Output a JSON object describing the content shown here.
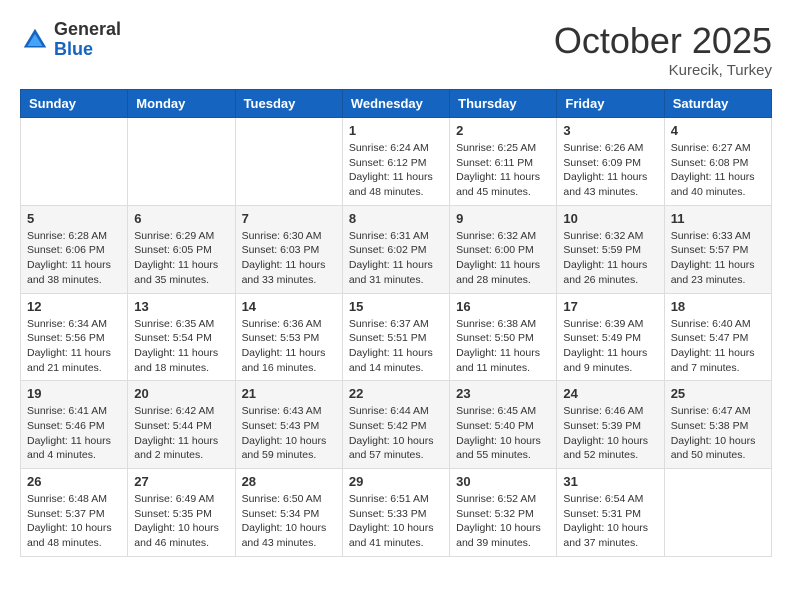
{
  "header": {
    "logo_general": "General",
    "logo_blue": "Blue",
    "month": "October 2025",
    "location": "Kurecik, Turkey"
  },
  "days_of_week": [
    "Sunday",
    "Monday",
    "Tuesday",
    "Wednesday",
    "Thursday",
    "Friday",
    "Saturday"
  ],
  "weeks": [
    [
      {
        "day": "",
        "sunrise": "",
        "sunset": "",
        "daylight": ""
      },
      {
        "day": "",
        "sunrise": "",
        "sunset": "",
        "daylight": ""
      },
      {
        "day": "",
        "sunrise": "",
        "sunset": "",
        "daylight": ""
      },
      {
        "day": "1",
        "sunrise": "Sunrise: 6:24 AM",
        "sunset": "Sunset: 6:12 PM",
        "daylight": "Daylight: 11 hours and 48 minutes."
      },
      {
        "day": "2",
        "sunrise": "Sunrise: 6:25 AM",
        "sunset": "Sunset: 6:11 PM",
        "daylight": "Daylight: 11 hours and 45 minutes."
      },
      {
        "day": "3",
        "sunrise": "Sunrise: 6:26 AM",
        "sunset": "Sunset: 6:09 PM",
        "daylight": "Daylight: 11 hours and 43 minutes."
      },
      {
        "day": "4",
        "sunrise": "Sunrise: 6:27 AM",
        "sunset": "Sunset: 6:08 PM",
        "daylight": "Daylight: 11 hours and 40 minutes."
      }
    ],
    [
      {
        "day": "5",
        "sunrise": "Sunrise: 6:28 AM",
        "sunset": "Sunset: 6:06 PM",
        "daylight": "Daylight: 11 hours and 38 minutes."
      },
      {
        "day": "6",
        "sunrise": "Sunrise: 6:29 AM",
        "sunset": "Sunset: 6:05 PM",
        "daylight": "Daylight: 11 hours and 35 minutes."
      },
      {
        "day": "7",
        "sunrise": "Sunrise: 6:30 AM",
        "sunset": "Sunset: 6:03 PM",
        "daylight": "Daylight: 11 hours and 33 minutes."
      },
      {
        "day": "8",
        "sunrise": "Sunrise: 6:31 AM",
        "sunset": "Sunset: 6:02 PM",
        "daylight": "Daylight: 11 hours and 31 minutes."
      },
      {
        "day": "9",
        "sunrise": "Sunrise: 6:32 AM",
        "sunset": "Sunset: 6:00 PM",
        "daylight": "Daylight: 11 hours and 28 minutes."
      },
      {
        "day": "10",
        "sunrise": "Sunrise: 6:32 AM",
        "sunset": "Sunset: 5:59 PM",
        "daylight": "Daylight: 11 hours and 26 minutes."
      },
      {
        "day": "11",
        "sunrise": "Sunrise: 6:33 AM",
        "sunset": "Sunset: 5:57 PM",
        "daylight": "Daylight: 11 hours and 23 minutes."
      }
    ],
    [
      {
        "day": "12",
        "sunrise": "Sunrise: 6:34 AM",
        "sunset": "Sunset: 5:56 PM",
        "daylight": "Daylight: 11 hours and 21 minutes."
      },
      {
        "day": "13",
        "sunrise": "Sunrise: 6:35 AM",
        "sunset": "Sunset: 5:54 PM",
        "daylight": "Daylight: 11 hours and 18 minutes."
      },
      {
        "day": "14",
        "sunrise": "Sunrise: 6:36 AM",
        "sunset": "Sunset: 5:53 PM",
        "daylight": "Daylight: 11 hours and 16 minutes."
      },
      {
        "day": "15",
        "sunrise": "Sunrise: 6:37 AM",
        "sunset": "Sunset: 5:51 PM",
        "daylight": "Daylight: 11 hours and 14 minutes."
      },
      {
        "day": "16",
        "sunrise": "Sunrise: 6:38 AM",
        "sunset": "Sunset: 5:50 PM",
        "daylight": "Daylight: 11 hours and 11 minutes."
      },
      {
        "day": "17",
        "sunrise": "Sunrise: 6:39 AM",
        "sunset": "Sunset: 5:49 PM",
        "daylight": "Daylight: 11 hours and 9 minutes."
      },
      {
        "day": "18",
        "sunrise": "Sunrise: 6:40 AM",
        "sunset": "Sunset: 5:47 PM",
        "daylight": "Daylight: 11 hours and 7 minutes."
      }
    ],
    [
      {
        "day": "19",
        "sunrise": "Sunrise: 6:41 AM",
        "sunset": "Sunset: 5:46 PM",
        "daylight": "Daylight: 11 hours and 4 minutes."
      },
      {
        "day": "20",
        "sunrise": "Sunrise: 6:42 AM",
        "sunset": "Sunset: 5:44 PM",
        "daylight": "Daylight: 11 hours and 2 minutes."
      },
      {
        "day": "21",
        "sunrise": "Sunrise: 6:43 AM",
        "sunset": "Sunset: 5:43 PM",
        "daylight": "Daylight: 10 hours and 59 minutes."
      },
      {
        "day": "22",
        "sunrise": "Sunrise: 6:44 AM",
        "sunset": "Sunset: 5:42 PM",
        "daylight": "Daylight: 10 hours and 57 minutes."
      },
      {
        "day": "23",
        "sunrise": "Sunrise: 6:45 AM",
        "sunset": "Sunset: 5:40 PM",
        "daylight": "Daylight: 10 hours and 55 minutes."
      },
      {
        "day": "24",
        "sunrise": "Sunrise: 6:46 AM",
        "sunset": "Sunset: 5:39 PM",
        "daylight": "Daylight: 10 hours and 52 minutes."
      },
      {
        "day": "25",
        "sunrise": "Sunrise: 6:47 AM",
        "sunset": "Sunset: 5:38 PM",
        "daylight": "Daylight: 10 hours and 50 minutes."
      }
    ],
    [
      {
        "day": "26",
        "sunrise": "Sunrise: 6:48 AM",
        "sunset": "Sunset: 5:37 PM",
        "daylight": "Daylight: 10 hours and 48 minutes."
      },
      {
        "day": "27",
        "sunrise": "Sunrise: 6:49 AM",
        "sunset": "Sunset: 5:35 PM",
        "daylight": "Daylight: 10 hours and 46 minutes."
      },
      {
        "day": "28",
        "sunrise": "Sunrise: 6:50 AM",
        "sunset": "Sunset: 5:34 PM",
        "daylight": "Daylight: 10 hours and 43 minutes."
      },
      {
        "day": "29",
        "sunrise": "Sunrise: 6:51 AM",
        "sunset": "Sunset: 5:33 PM",
        "daylight": "Daylight: 10 hours and 41 minutes."
      },
      {
        "day": "30",
        "sunrise": "Sunrise: 6:52 AM",
        "sunset": "Sunset: 5:32 PM",
        "daylight": "Daylight: 10 hours and 39 minutes."
      },
      {
        "day": "31",
        "sunrise": "Sunrise: 6:54 AM",
        "sunset": "Sunset: 5:31 PM",
        "daylight": "Daylight: 10 hours and 37 minutes."
      },
      {
        "day": "",
        "sunrise": "",
        "sunset": "",
        "daylight": ""
      }
    ]
  ]
}
